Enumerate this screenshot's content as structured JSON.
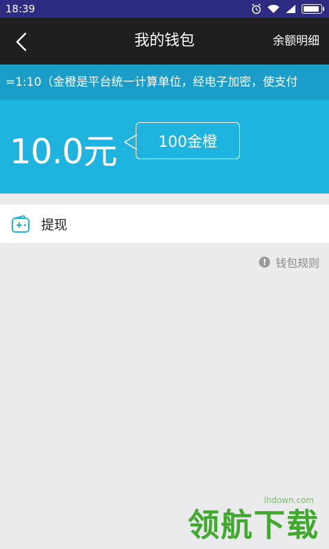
{
  "status_bar": {
    "time": "18:39",
    "icons": [
      "alarm-icon",
      "wifi-icon",
      "signal-icon",
      "battery-icon"
    ],
    "battery_level": 0.9
  },
  "nav": {
    "title": "我的钱包",
    "right_action": "余额明细",
    "back_icon": "chevron-left-icon"
  },
  "notice": {
    "text": "=1:10（金橙是平台统一计算单位，经电子加密，使支付"
  },
  "balance": {
    "amount": "10.0元",
    "coins": "100金橙"
  },
  "menu": {
    "withdraw_label": "提现",
    "withdraw_icon": "wallet-plus-icon"
  },
  "rules": {
    "label": "钱包规则",
    "icon": "info-icon",
    "icon_glyph": "!"
  },
  "watermark": {
    "site": "lhdown.com",
    "brand": "领航下载"
  },
  "colors": {
    "status_bar": "#2e2c82",
    "nav_bar": "#1f1f1f",
    "notice_bar": "#1a9ec9",
    "balance_panel": "#1fb4e0",
    "background": "#ebebed",
    "accent_icon": "#1fb4e0"
  }
}
